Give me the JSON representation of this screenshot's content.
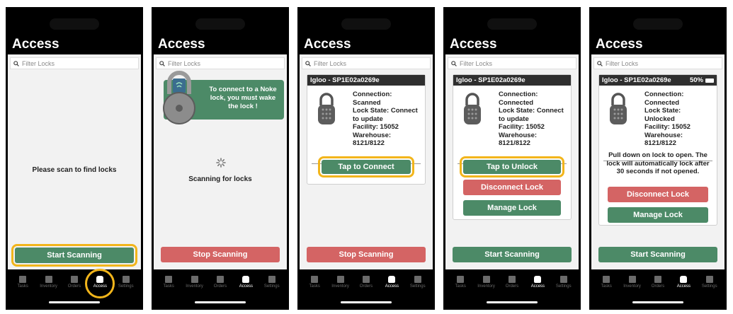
{
  "app_title": "Access",
  "search_placeholder": "Filter Locks",
  "tabs": [
    "Tasks",
    "Inventory",
    "Orders",
    "Access",
    "Settings"
  ],
  "screens": {
    "s1": {
      "message": "Please scan to find locks",
      "button": "Start Scanning"
    },
    "s2": {
      "banner_text": "To connect to a Noke lock, you must wake the lock !",
      "status": "Scanning for locks",
      "button": "Stop Scanning"
    },
    "s3": {
      "lock_name": "Igloo - SP1E02a0269e",
      "info": [
        "Connection:",
        "Scanned",
        "Lock State: Connect",
        "to update",
        "Facility: 15052",
        "Warehouse:",
        "8121/8122"
      ],
      "connect_button": "Tap to Connect",
      "button": "Stop Scanning"
    },
    "s4": {
      "lock_name": "Igloo - SP1E02a0269e",
      "info": [
        "Connection:",
        "Connected",
        "Lock State: Connect",
        "to update",
        "Facility: 15052",
        "Warehouse:",
        "8121/8122"
      ],
      "unlock_button": "Tap to Unlock",
      "disconnect_button": "Disconnect Lock",
      "manage_button": "Manage Lock",
      "button": "Start Scanning"
    },
    "s5": {
      "lock_name": "Igloo - SP1E02a0269e",
      "battery": "50%",
      "info": [
        "Connection:",
        "Connected",
        "Lock State:",
        "Unlocked",
        "Facility: 15052",
        "Warehouse:",
        "8121/8122"
      ],
      "instruction": "Pull down on lock to open. The lock will automatically lock after 30 seconds if not opened.",
      "disconnect_button": "Disconnect Lock",
      "manage_button": "Manage Lock",
      "button": "Start Scanning"
    }
  },
  "colors": {
    "green": "#4c8a67",
    "red": "#d46464",
    "highlight": "#f2b51b"
  }
}
